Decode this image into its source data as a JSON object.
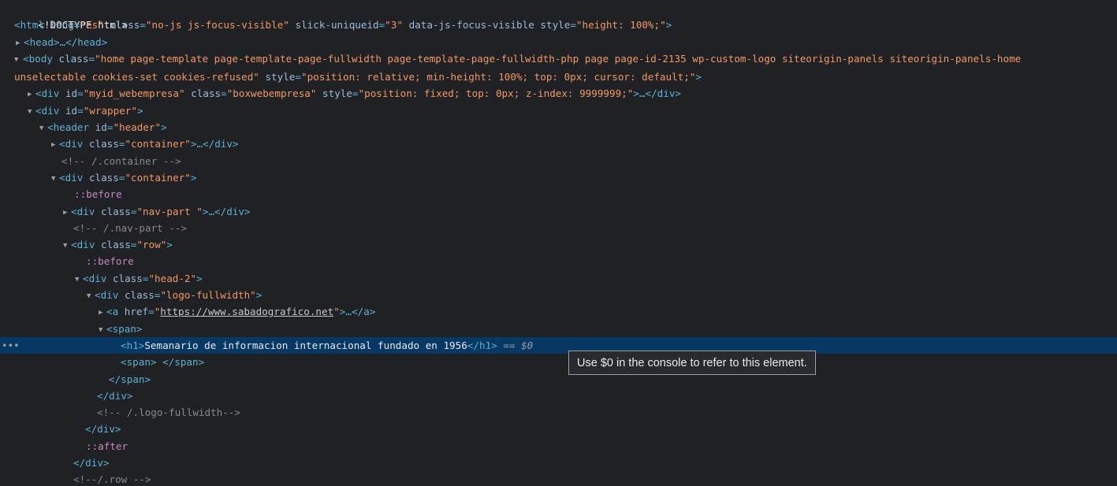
{
  "lines": {
    "doctype": "<!DOCTYPE html>",
    "html": {
      "open": "<html",
      "attrs": [
        {
          "name": "lang",
          "value": "\"es\""
        },
        {
          "name": "class",
          "value": "\"no-js js-focus-visible\""
        },
        {
          "name": "slick-uniqueid",
          "value": "\"3\""
        },
        {
          "name": "data-js-focus-visible",
          "value": ""
        },
        {
          "name": "style",
          "value": "\"height: 100%;\""
        }
      ],
      "close": ">"
    },
    "head": {
      "text": "<head>…</head>"
    },
    "body": {
      "open": "<body",
      "class_name": "class",
      "class_value_1": "\"home page-template page-template-page-fullwidth page-template-page-fullwidth-php page page-id-2135 wp-custom-logo siteorigin-panels siteorigin-panels-home",
      "class_value_2": "unselectable cookies-set cookies-refused\"",
      "style_name": "style",
      "style_value": "\"position: relative; min-height: 100%; top: 0px; cursor: default;\"",
      "close": ">"
    },
    "myid": {
      "open": "<div",
      "id_name": "id",
      "id_value": "\"myid_webempresa\"",
      "class_name": "class",
      "class_value": "\"boxwebempresa\"",
      "style_name": "style",
      "style_value": "\"position: fixed; top: 0px; z-index: 9999999;\"",
      "close": ">…</div>"
    },
    "wrapper": {
      "open": "<div",
      "attr_name": "id",
      "attr_value": "\"wrapper\"",
      "close": ">"
    },
    "header": {
      "open": "<header",
      "attr_name": "id",
      "attr_value": "\"header\"",
      "close": ">"
    },
    "container1": {
      "open": "<div",
      "attr_name": "class",
      "attr_value": "\"container\"",
      "close": ">…</div>"
    },
    "comment_container": "<!-- /.container -->",
    "container2": {
      "open": "<div",
      "attr_name": "class",
      "attr_value": "\"container\"",
      "close": ">"
    },
    "before1": "::before",
    "navpart": {
      "open": "<div",
      "attr_name": "class",
      "attr_value": "\"nav-part \"",
      "close": ">…</div>"
    },
    "comment_navpart": "<!-- /.nav-part -->",
    "row": {
      "open": "<div",
      "attr_name": "class",
      "attr_value": "\"row\"",
      "close": ">"
    },
    "before2": "::before",
    "head2": {
      "open": "<div",
      "attr_name": "class",
      "attr_value": "\"head-2\"",
      "close": ">"
    },
    "logo": {
      "open": "<div",
      "attr_name": "class",
      "attr_value": "\"logo-fullwidth\"",
      "close": ">"
    },
    "anchor": {
      "open": "<a",
      "attr_name": "href",
      "quote_open": "\"",
      "link": "https://www.sabadografico.net",
      "quote_close": "\"",
      "close": ">…</a>"
    },
    "span_open": "<span>",
    "h1": {
      "open": "<h1>",
      "text": "Semanario de informacion internacional fundado en 1956",
      "close": "</h1>",
      "eq": "==",
      "ref": "$0"
    },
    "span_empty": {
      "open": "<span>",
      "text": " ",
      "close": "</span>"
    },
    "span_close": "</span>",
    "div_close1": "</div>",
    "comment_logo": "<!-- /.logo-fullwidth-->",
    "div_close2": "</div>",
    "after": "::after",
    "div_close3": "</div>",
    "comment_row": "<!--/.row -->"
  },
  "gutter_ellipsis": "•••",
  "tooltip": "Use $0 in the console to refer to this element."
}
